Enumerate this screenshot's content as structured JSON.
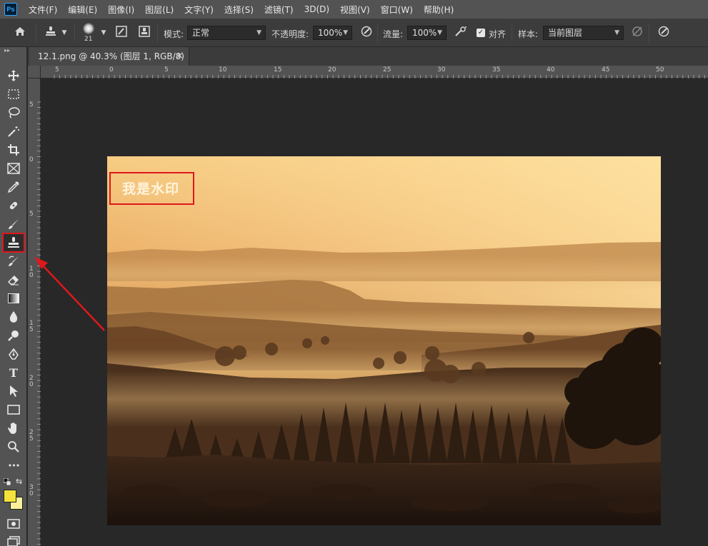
{
  "app": {
    "logo": "Ps"
  },
  "menu": [
    "文件(F)",
    "编辑(E)",
    "图像(I)",
    "图层(L)",
    "文字(Y)",
    "选择(S)",
    "滤镜(T)",
    "3D(D)",
    "视图(V)",
    "窗口(W)",
    "帮助(H)"
  ],
  "options": {
    "brush_size": "21",
    "mode_label": "模式:",
    "mode_value": "正常",
    "opacity_label": "不透明度:",
    "opacity_value": "100%",
    "flow_label": "流量:",
    "flow_value": "100%",
    "aligned_label": "对齐",
    "aligned_checked": true,
    "sample_label": "样本:",
    "sample_value": "当前图层"
  },
  "document": {
    "tab_title": "12.1.png @ 40.3% (图层 1, RGB/8)",
    "close_glyph": "×"
  },
  "ruler": {
    "top": [
      "5",
      "0",
      "5",
      "10",
      "15",
      "20",
      "25",
      "30",
      "35",
      "40",
      "45",
      "50"
    ],
    "left": [
      "5",
      "0",
      "5",
      "1\n0",
      "1\n5",
      "2\n0",
      "2\n5",
      "3\n0"
    ]
  },
  "canvas": {
    "watermark": "我是水印"
  },
  "colors": {
    "foreground": "#f3e23b",
    "background": "#fbf09a",
    "highlight": "#e0181b"
  },
  "tools": [
    "move-icon",
    "marquee-icon",
    "lasso-icon",
    "magic-wand-icon",
    "crop-icon",
    "frame-icon",
    "eyedropper-icon",
    "healing-brush-icon",
    "brush-icon",
    "clone-stamp-icon",
    "history-brush-icon",
    "eraser-icon",
    "gradient-icon",
    "blur-icon",
    "dodge-icon",
    "pen-icon",
    "type-icon",
    "path-selection-icon",
    "rectangle-icon",
    "hand-icon",
    "zoom-icon",
    "more-tools-icon"
  ],
  "tool_glyphs": {
    "type": "T",
    "more": "•••"
  }
}
